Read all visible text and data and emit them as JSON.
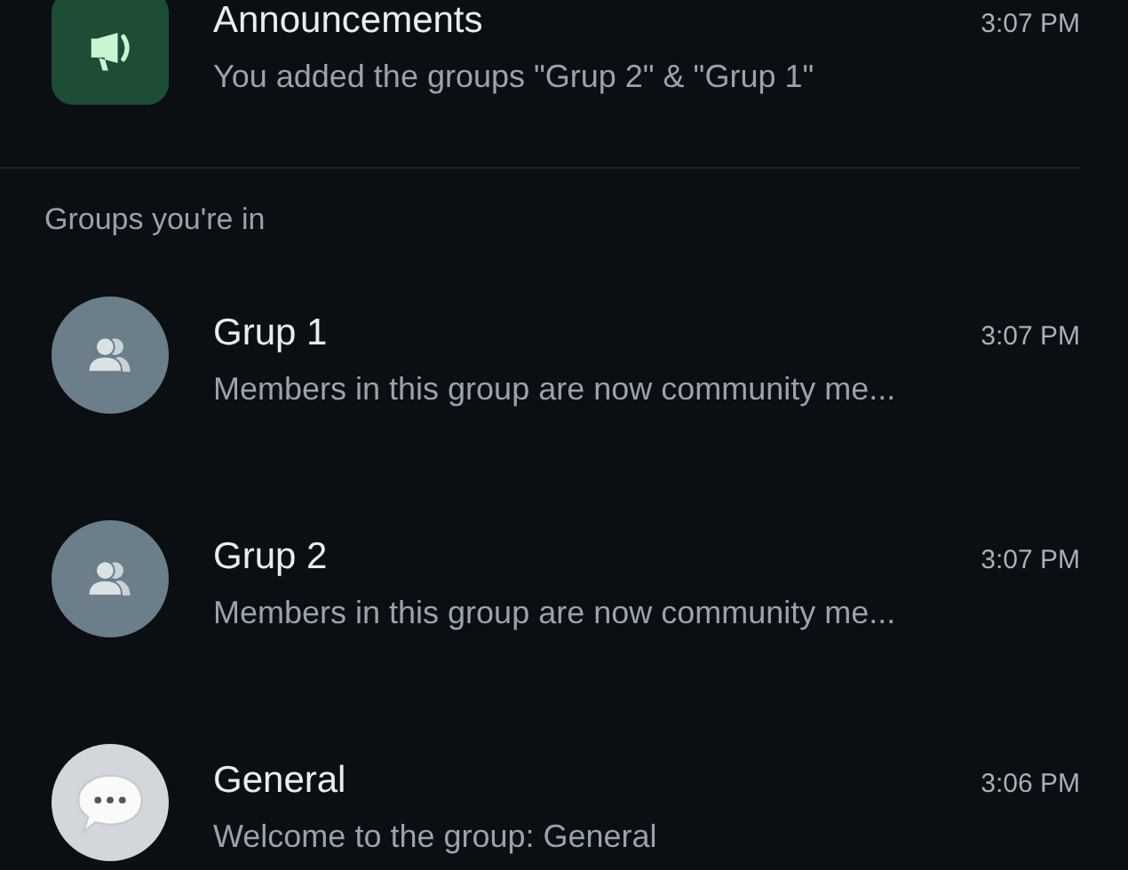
{
  "announcement": {
    "kind": "announcement",
    "title": "Announcements",
    "time": "3:07 PM",
    "preview": "You added the groups \"Grup 2\" & \"Grup 1\""
  },
  "section_header": "Groups you're in",
  "chats": [
    {
      "kind": "group",
      "title": "Grup 1",
      "time": "3:07 PM",
      "preview": "Members in this group are now community me..."
    },
    {
      "kind": "group",
      "title": "Grup 2",
      "time": "3:07 PM",
      "preview": "Members in this group are now community me..."
    },
    {
      "kind": "general",
      "title": "General",
      "time": "3:06 PM",
      "preview": "Welcome to the group: General"
    }
  ]
}
